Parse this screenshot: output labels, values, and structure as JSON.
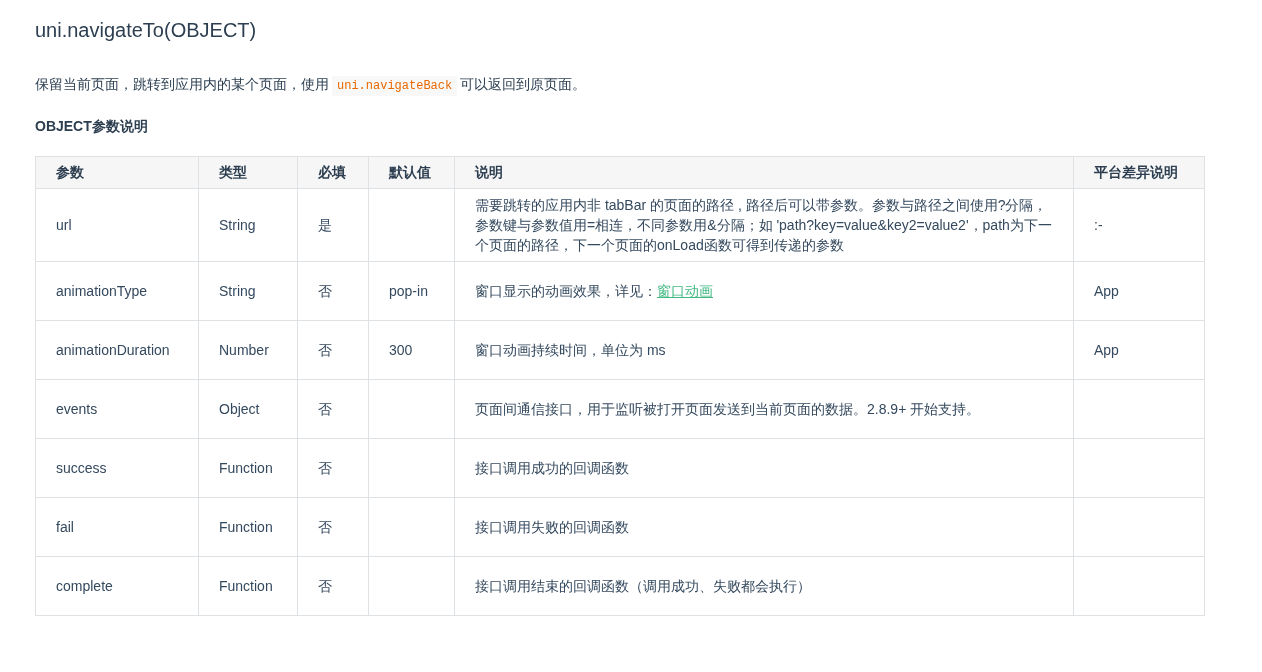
{
  "title": "uni.navigateTo(OBJECT)",
  "intro": {
    "before": "保留当前页面，跳转到应用内的某个页面，使用",
    "code": "uni.navigateBack",
    "after": "可以返回到原页面。"
  },
  "section_heading": "OBJECT参数说明",
  "table": {
    "columns": [
      "参数",
      "类型",
      "必填",
      "默认值",
      "说明",
      "平台差异说明"
    ],
    "rows": [
      {
        "name": "url",
        "type": "String",
        "required": "是",
        "description": "需要跳转的应用内非 tabBar 的页面的路径 , 路径后可以带参数。参数与路径之间使用?分隔，参数键与参数值用=相连，不同参数用&分隔；如 'path?key=value&key2=value2'，path为下一个页面的路径，下一个页面的onLoad函数可得到传递的参数",
        "platform": ":-"
      },
      {
        "name": "animationType",
        "type": "String",
        "required": "否",
        "default": "pop-in",
        "description": "窗口显示的动画效果，详见：",
        "link": "窗口动画",
        "platform": "App"
      },
      {
        "name": "animationDuration",
        "type": "Number",
        "required": "否",
        "default": "300",
        "description": "窗口动画持续时间，单位为 ms",
        "platform": "App"
      },
      {
        "name": "events",
        "type": "Object",
        "required": "否",
        "description": "页面间通信接口，用于监听被打开页面发送到当前页面的数据。2.8.9+ 开始支持。"
      },
      {
        "name": "success",
        "type": "Function",
        "required": "否",
        "description": "接口调用成功的回调函数"
      },
      {
        "name": "fail",
        "type": "Function",
        "required": "否",
        "description": "接口调用失败的回调函数"
      },
      {
        "name": "complete",
        "type": "Function",
        "required": "否",
        "description": "接口调用结束的回调函数（调用成功、失败都会执行）"
      }
    ]
  }
}
